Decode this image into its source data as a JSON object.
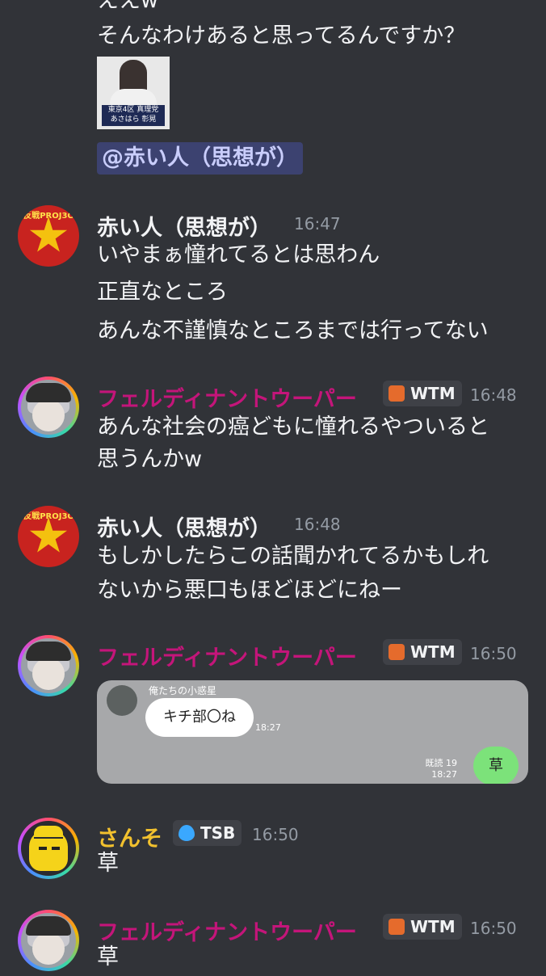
{
  "top_message": {
    "partial_line": "ええw",
    "text": "そんなわけあると思ってるんですか？",
    "image_caption_small": "東京4区 真理党",
    "image_caption": "あさはら 彰晃",
    "mention": "@赤い人（思想が）"
  },
  "messages": [
    {
      "author": "赤い人（思想が）",
      "time": "16:47",
      "lines": [
        "いやまぁ憧れてるとは思わん",
        "正直なところ",
        "あんな不謹慎なところまでは行ってない"
      ],
      "avatar_text": "反戦PROJ3C"
    },
    {
      "author": "フェルディナントウーパー",
      "tag": "WTM",
      "time": "16:48",
      "lines": [
        "あんな社会の癌どもに憧れるやついると",
        "思うんかw"
      ]
    },
    {
      "author": "赤い人（思想が）",
      "time": "16:48",
      "lines": [
        "もしかしたらこの話聞かれてるかもしれ",
        "ないから悪口もほどほどにねー"
      ],
      "avatar_text": "反戦PROJ3C"
    },
    {
      "author": "フェルディナントウーパー",
      "tag": "WTM",
      "time": "16:50",
      "screenshot": {
        "sender": "俺たちの小惑星",
        "incoming_text": "キチ部〇ね",
        "incoming_time": "18:27",
        "read_status": "既読 19",
        "outgoing_time": "18:27",
        "outgoing_text": "草"
      }
    },
    {
      "author": "さんそ",
      "tag": "TSB",
      "time": "16:50",
      "lines": [
        "草"
      ]
    },
    {
      "author": "フェルディナントウーパー",
      "tag": "WTM",
      "time": "16:50",
      "lines": [
        "草"
      ]
    }
  ],
  "colors": {
    "background": "#313338",
    "pink_name": "#c4157a",
    "yellow_name": "#f2c12e",
    "mention_bg": "#3c4270"
  }
}
